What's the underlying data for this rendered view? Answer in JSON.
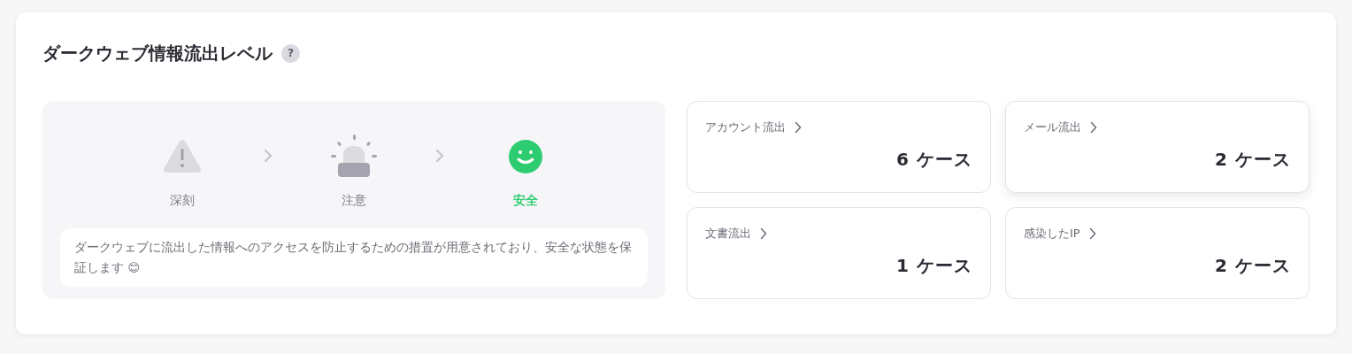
{
  "title": "ダークウェブ情報流出レベル",
  "help_badge": "?",
  "levels": [
    {
      "kind": "severe",
      "label": "深刻",
      "selected": false
    },
    {
      "kind": "caution",
      "label": "注意",
      "selected": false
    },
    {
      "kind": "safe",
      "label": "安全",
      "selected": true
    }
  ],
  "message": "ダークウェブに流出した情報へのアクセスを防止するための措置が用意されており、安全な状態を保証します 😊",
  "cards": [
    {
      "label": "アカウント流出",
      "count": "6",
      "unit": "ケース",
      "hovered": false
    },
    {
      "label": "メール流出",
      "count": "2",
      "unit": "ケース",
      "hovered": true
    },
    {
      "label": "文書流出",
      "count": "1",
      "unit": "ケース",
      "hovered": false
    },
    {
      "label": "感染したIP",
      "count": "2",
      "unit": "ケース",
      "hovered": false
    }
  ]
}
